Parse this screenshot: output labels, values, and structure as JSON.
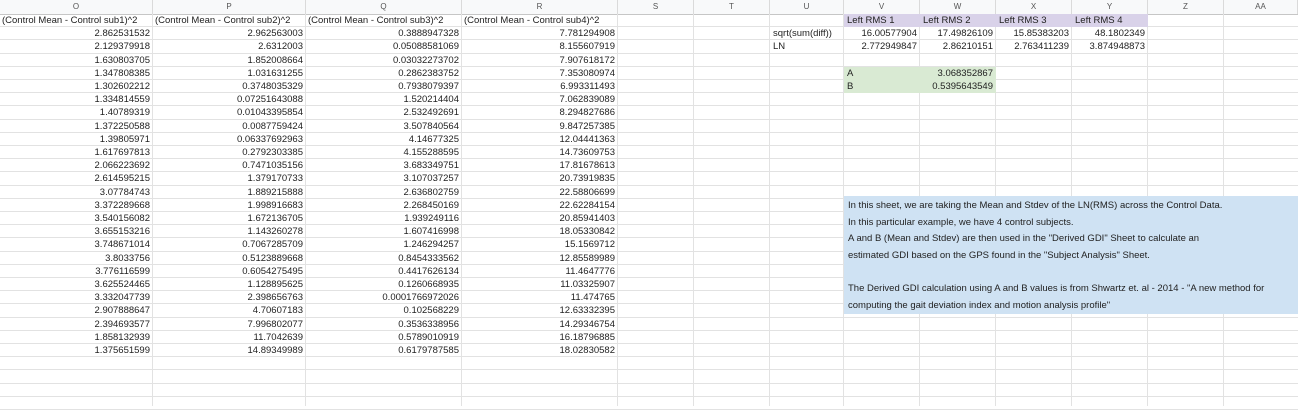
{
  "columns": [
    "O",
    "P",
    "Q",
    "R",
    "S",
    "T",
    "U",
    "V",
    "W",
    "X",
    "Y",
    "Z",
    "AA"
  ],
  "table": {
    "headers": [
      "(Control Mean - Control sub1)^2",
      "(Control Mean - Control sub2)^2",
      "(Control Mean - Control sub3)^2",
      "(Control Mean - Control sub4)^2"
    ],
    "rows": [
      [
        "2.862531532",
        "2.962563003",
        "0.3888947328",
        "7.781294908"
      ],
      [
        "2.129379918",
        "2.6312003",
        "0.05088581069",
        "8.155607919"
      ],
      [
        "1.630803705",
        "1.852008664",
        "0.03032273702",
        "7.907618172"
      ],
      [
        "1.347808385",
        "1.031631255",
        "0.2862383752",
        "7.353080974"
      ],
      [
        "1.302602212",
        "0.3748035329",
        "0.7938079397",
        "6.993311493"
      ],
      [
        "1.334814559",
        "0.07251643088",
        "1.520214404",
        "7.062839089"
      ],
      [
        "1.40789319",
        "0.01043395854",
        "2.532492691",
        "8.294827686"
      ],
      [
        "1.372250588",
        "0.0087759424",
        "3.507840564",
        "9.847257385"
      ],
      [
        "1.39805971",
        "0.06337692963",
        "4.14677325",
        "12.04441363"
      ],
      [
        "1.617697813",
        "0.2792303385",
        "4.155288595",
        "14.73609753"
      ],
      [
        "2.066223692",
        "0.7471035156",
        "3.683349751",
        "17.81678613"
      ],
      [
        "2.614595215",
        "1.379170733",
        "3.107037257",
        "20.73919835"
      ],
      [
        "3.07784743",
        "1.889215888",
        "2.636802759",
        "22.58806699"
      ],
      [
        "3.372289668",
        "1.998916683",
        "2.268450169",
        "22.62284154"
      ],
      [
        "3.540156082",
        "1.672136705",
        "1.939249116",
        "20.85941403"
      ],
      [
        "3.655153216",
        "1.143260278",
        "1.607416998",
        "18.05330842"
      ],
      [
        "3.748671014",
        "0.7067285709",
        "1.246294257",
        "15.1569712"
      ],
      [
        "3.8033756",
        "0.5123889668",
        "0.8454333562",
        "12.85589989"
      ],
      [
        "3.776116599",
        "0.6054275495",
        "0.4417626134",
        "11.4647776"
      ],
      [
        "3.625524465",
        "1.128895625",
        "0.1260668935",
        "11.03325907"
      ],
      [
        "3.332047739",
        "2.398656763",
        "0.0001766972026",
        "11.474765"
      ],
      [
        "2.907888647",
        "4.70607183",
        "0.102568229",
        "12.63332395"
      ],
      [
        "2.394693577",
        "7.996802077",
        "0.3536338956",
        "14.29346754"
      ],
      [
        "1.858132939",
        "11.7042639",
        "0.5789010919",
        "16.18796885"
      ],
      [
        "1.375651599",
        "14.89349989",
        "0.6179787585",
        "18.02830582"
      ]
    ]
  },
  "rms": {
    "headers": [
      "Left RMS 1",
      "Left RMS 2",
      "Left RMS 3",
      "Left RMS 4"
    ],
    "row1_label": "sqrt(sum(diff))",
    "row1": [
      "16.00577904",
      "17.49826109",
      "15.85383203",
      "48.1802349"
    ],
    "row2_label": "LN",
    "row2": [
      "2.772949847",
      "2.86210151",
      "2.763411239",
      "3.874948873"
    ]
  },
  "ab": {
    "a_label": "A",
    "a_value": "3.068352867",
    "b_label": "B",
    "b_value": "0.5395643549"
  },
  "note": {
    "lines": [
      "In this sheet, we are taking the Mean and Stdev of the LN(RMS) across the Control Data.",
      "In this particular example, we have 4 control subjects.",
      "A and B (Mean and Stdev) are then used in the \"Derived GDI\" Sheet to calculate an",
      "estimated GDI based on the GPS found in the \"Subject Analysis\" Sheet.",
      "",
      "The Derived GDI calculation using A and B values is from Shwartz et. al - 2014 - \"A new method for",
      "computing the gait deviation index and motion analysis profile\""
    ]
  }
}
